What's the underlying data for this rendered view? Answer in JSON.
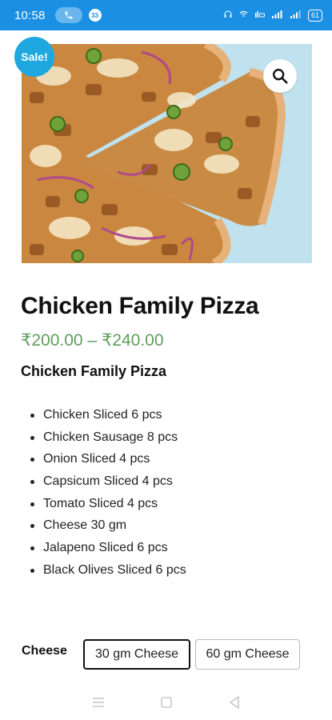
{
  "status_bar": {
    "time": "10:58",
    "call_icon": "phone-icon",
    "notification_count": "33",
    "battery_level": "61"
  },
  "product": {
    "sale_badge": "Sale!",
    "title": "Chicken Family Pizza",
    "price": "₹200.00 – ₹240.00",
    "subtitle": "Chicken Family Pizza",
    "ingredients": [
      "Chicken Sliced 6 pcs",
      "Chicken Sausage 8 pcs",
      "Onion Sliced 4 pcs",
      "Capsicum Sliced 4 pcs",
      "Tomato Sliced 4 pcs",
      "Cheese 30 gm",
      "Jalapeno Sliced 6 pcs",
      "Black Olives Sliced 6 pcs"
    ]
  },
  "options": {
    "label": "Cheese",
    "values": [
      "30 gm Cheese",
      "60 gm Cheese"
    ],
    "selected": "30 gm Cheese"
  },
  "colors": {
    "status_bar": "#1a8fe3",
    "sale_badge": "#1fa8e0",
    "price": "#5e9e5e"
  },
  "icons": {
    "zoom": "search-icon",
    "nav_menu": "menu-icon",
    "nav_home": "square-home-icon",
    "nav_back": "triangle-back-icon"
  }
}
